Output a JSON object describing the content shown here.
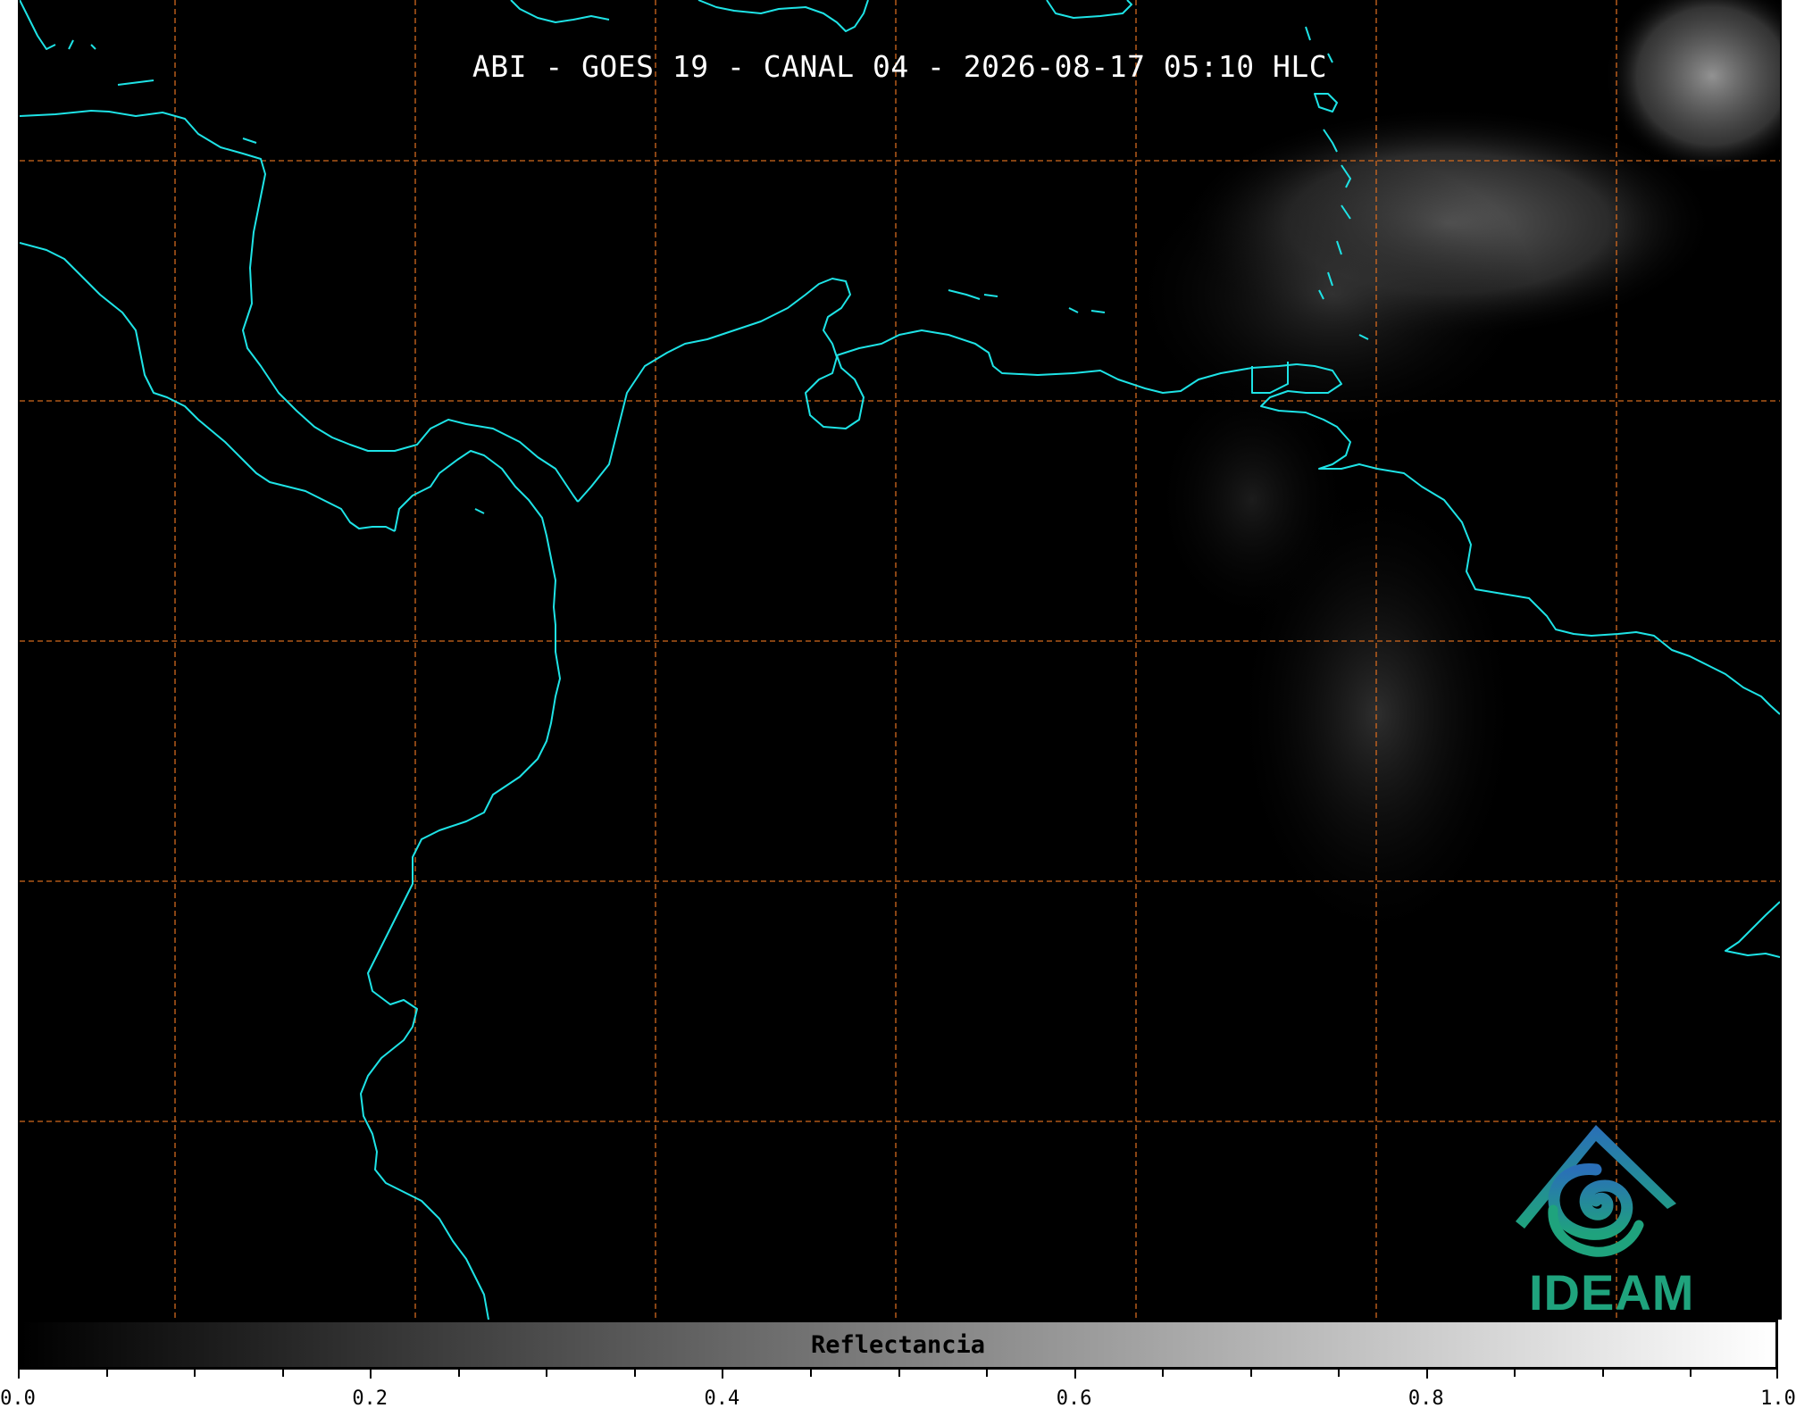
{
  "title": "ABI - GOES 19 - CANAL 04 - 2026-08-17 05:10 HLC",
  "logo": {
    "text": "IDEAM"
  },
  "colorbar": {
    "label": "Reflectancia",
    "range": [
      0.0,
      1.0
    ],
    "ticks": [
      "0.0",
      "0.2",
      "0.4",
      "0.6",
      "0.8",
      "1.0"
    ],
    "colormap": "grayscale",
    "colors": {
      "min": "#000000",
      "max": "#ffffff"
    }
  },
  "map": {
    "background": "#000000",
    "coastline_color": "#1ee3e6",
    "gridline_color": "#d2691e",
    "gridline_style": "dashed"
  }
}
